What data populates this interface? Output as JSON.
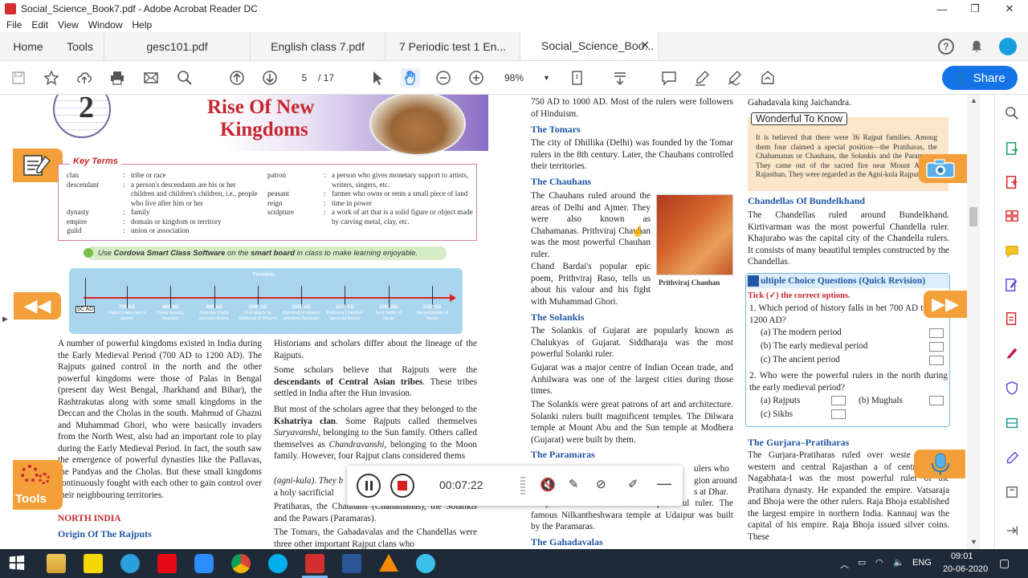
{
  "window": {
    "title": "Social_Science_Book7.pdf - Adobe Acrobat Reader DC",
    "minimize": "—",
    "maximize": "❐",
    "close": "✕"
  },
  "menu": [
    "File",
    "Edit",
    "View",
    "Window",
    "Help"
  ],
  "tabs": {
    "home": "Home",
    "tools": "Tools",
    "docs": [
      "gesc101.pdf",
      "English class 7.pdf",
      "7 Periodic test 1 En...",
      "Social_Science_Boo..."
    ],
    "close": "✕"
  },
  "toolbar": {
    "page_current": "5",
    "page_total": "/ 17",
    "zoom": "98%",
    "share": "Share"
  },
  "recorder": {
    "time": "00:07:22"
  },
  "taskbar": {
    "lang": "ENG",
    "time": "09:01",
    "date": "20-06-2020"
  },
  "page": {
    "chapter_num": "2",
    "chapter_title_1": "Rise Of New",
    "chapter_title_2": "Kingdoms",
    "key_terms_label": "Key Terms",
    "key_terms_left": [
      [
        "clan",
        ":",
        "tribe or race"
      ],
      [
        "descendant",
        ":",
        "a person's descendants are his or her children and children's children, i.e., people who live after him or her"
      ],
      [
        "dynasty",
        ":",
        "family"
      ],
      [
        "empire",
        ":",
        "domain or kingdom or territory"
      ],
      [
        "guild",
        ":",
        "union or association"
      ]
    ],
    "key_terms_right": [
      [
        "patron",
        ":",
        "a person who gives monetary support to artists, writers, singers, etc."
      ],
      [
        "peasant",
        ":",
        "farmer who owns or rents a small piece of land"
      ],
      [
        "reign",
        ":",
        "time in power"
      ],
      [
        "sculpture",
        ":",
        "a work of art that is a solid figure or object made by carving metal, clay, etc."
      ]
    ],
    "cordova_1": "Use ",
    "cordova_2": "Cordova Smart Class Software",
    "cordova_3": " on the ",
    "cordova_4": "smart board",
    "cordova_5": " in class to make learning enjoyable.",
    "timeline_label": "Timeline",
    "timeline_start": "5C AD",
    "timeline": [
      {
        "year": "750 AD",
        "text": "Rajput rulers rise in power"
      },
      {
        "year": "800 AD",
        "text": "Chola dynasty founded"
      },
      {
        "year": "985 AD",
        "text": "Rajaraja Chola ascends throne"
      },
      {
        "year": "1000 AD",
        "text": "First attack by Mahmud of Ghazni"
      },
      {
        "year": "1025 AD",
        "text": "Mahmud of Ghazni plunders Somnath"
      },
      {
        "year": "1178 AD",
        "text": "Prithviraj Chauhan ascends throne"
      },
      {
        "year": "1191 AD",
        "text": "First battle of Tarain"
      },
      {
        "year": "1192 AD",
        "text": "Second battle of Tarain"
      }
    ],
    "col1_para": "A number of powerful kingdoms existed in India during the Early Medieval Period (700 AD to 1200 AD). The Rajputs gained control in the north and the other powerful kingdoms were those of Palas in Bengal (present day West Bengal, Jharkhand and Bihar), the Rashtrakutas along with some small kingdoms in the Deccan and the Cholas in the south. Mahmud of Ghazni and Muhammad Ghori, who were basically invaders from the North West, also had an important role to play during the Early Medieval Period. In fact, the south saw the emergence of powerful dynasties like the Pallavas, the Pandyas and the Cholas. But these small kingdoms continuously fought with each other to gain control over their neighbouring territories.",
    "north_india": "NORTH INDIA",
    "origin_rajputs": "Origin Of The Rajputs",
    "col2_p1": "Historians and scholars differ about the lineage of the Rajputs.",
    "col2_p2a": "Some scholars believe that Rajputs were the ",
    "col2_p2b": "descendants of Central Asian tribes",
    "col2_p2c": ". These tribes settled in India after the Hun invasion.",
    "col2_p3a": "But most of the scholars agree that they belonged to the ",
    "col2_p3b": "Kshatriya clan",
    "col2_p3c": ". Some Rajputs called themselves ",
    "col2_p3d": "Suryavanshi",
    "col2_p3e": ", belonging to the Sun family. Others called themselves as ",
    "col2_p3f": "Chandravanshi",
    "col2_p3g": ", belonging to the Moon family. However, four Rajput clans considered thems",
    "col2_p3h": "(agni-kula). They b",
    "col2_p3i": "a holy sacrificial",
    "col2_p3j": "Pratiharas, the Chauhans (Chahamanas), the Solankis and the Pawars (Paramaras).",
    "col2_p4": "The Tomars, the Gahadavalas and the Chandellas were three other important Rajput clans who",
    "col3_top": "750 AD to 1000 AD. Most of the rulers were followers of Hinduism.",
    "tomars_h": "The Tomars",
    "tomars_p": "The city of Dhillika (Delhi) was founded by the Tomar rulers in the 8th century. Later, the Chauhans controlled their territories.",
    "chauhans_h": "The Chauhans",
    "chauhans_p": "The Chauhans ruled around the areas of Delhi and Ajmer. They were also known as Chahamanas. Prithviraj Chauhan was the most powerful Chauhan ruler.",
    "chand_p": "Chand Bardai's popular epic poem, Prithviraj Raso, tells us about his valour and his fight with Muhammad Ghori.",
    "prithviraj_caption": "Prithviraj Chauhan",
    "solankis_h": "The Solankis",
    "solankis_p1": "The Solankis of Gujarat are popularly known as Chalukyas of Gujarat. Siddharaja was the most powerful Solanki ruler.",
    "solankis_p2": "Gujarat was a major centre of Indian Ocean trade, and Anhilwara was one of the largest cities during those times.",
    "solankis_p3": "The Solankis were great patrons of art and architecture. Solanki rulers built magnificent temples. The Dilwara temple at Mount Abu and the Sun temple at Modhera (Gujarat) were built by them.",
    "paramaras_h": "The Paramaras",
    "paramaras_frag1": "ulers who",
    "paramaras_frag2": "gion around",
    "paramaras_frag3": "s at Dhar.",
    "paramaras_p": "Bhoja Paramara was the most powerful ruler. The famous Nilkantheshwara temple at Udaipur was built by the Paramaras.",
    "gahadavalas_h": "The Gahadavalas",
    "col4_top": "Gahadavala king Jaichandra.",
    "wonderful_label": "Wonderful To Know",
    "wonderful_text": "It is believed that there were 36 Rajput families. Among them four claimed a special position—the Pratiharas, the Chahamanas or Chauhans, the Solankis and the Paramaras. They came out of the sacred fire near Mount Abu in Rajasthan. They were regarded as the Agni-kula Rajputs.",
    "chandellas_h": "Chandellas Of Bundelkhand",
    "chandellas_p": "The Chandellas ruled around Bundelkhand. Kirtivarman was the most powerful Chandella ruler. Khajuraho was the capital city of the Chandella rulers. It consists of many beautiful temples constructed by the Chandellas.",
    "mcq_h1": "ultiple Choice Questions",
    "mcq_h2": "(Quick Revision)",
    "mcq_tick": "Tick (✓) the correct options.",
    "mcq_q1": "1.  Which period of history falls in bet 700 AD to 1200 AD?",
    "mcq_q1_opts": [
      "(a)  The modern period",
      "(b)  The early medieval period",
      "(c)  The ancient period"
    ],
    "mcq_q2": "2.  Who were the powerful rulers in the north during the early medieval period?",
    "mcq_q2_a": "(a)  Rajputs",
    "mcq_q2_b": "(b)  Mughals",
    "mcq_q2_c": "(c)  Sikhs",
    "gurjara_h": "The Gurjara–Pratiharas",
    "gurjara_p": "The Gurjara-Pratiharas ruled over weste parts of western and central Rajasthan a of central India. Nagabhata-I was the most powerful ruler of the Pratihara dynasty. He expanded the empire. Vatsaraja and Bhoja were the other rulers. Raja Bhoja established the largest empire in northern India. Kannauj was the capital of his empire. Raja Bhoja issued silver coins. These",
    "tools_label": "Tools"
  }
}
